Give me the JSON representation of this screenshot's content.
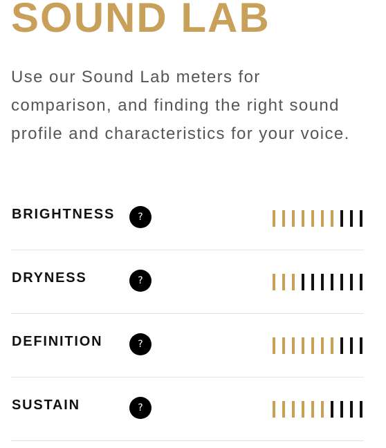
{
  "header": {
    "title": "SOUND LAB"
  },
  "intro": {
    "text": "Use our Sound Lab meters for comparison, and finding the right sound profile and characteristics for your voice."
  },
  "help_icon": {
    "glyph": "?",
    "icon": "question-mark-icon"
  },
  "colors": {
    "accent": "#c9a05a",
    "inactive": "#111111"
  },
  "meters": [
    {
      "label": "BRIGHTNESS",
      "level": 7,
      "max": 10
    },
    {
      "label": "DRYNESS",
      "level": 3,
      "max": 10
    },
    {
      "label": "DEFINITION",
      "level": 7,
      "max": 10
    },
    {
      "label": "SUSTAIN",
      "level": 6,
      "max": 10
    }
  ]
}
